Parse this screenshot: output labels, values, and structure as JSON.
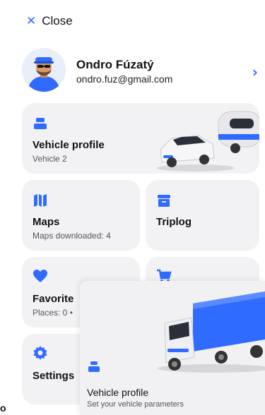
{
  "header": {
    "close_label": "Close",
    "close_icon": "close-icon"
  },
  "profile": {
    "name": "Ondro Fúzatý",
    "email": "ondro.fuz@gmail.com"
  },
  "cards": {
    "vehicle": {
      "title": "Vehicle profile",
      "subtitle": "Vehicle 2"
    },
    "maps": {
      "title": "Maps",
      "subtitle": "Maps downloaded: 4"
    },
    "triplog": {
      "title": "Triplog"
    },
    "favorites": {
      "title": "Favorite",
      "subtitle": "Places: 0 •"
    },
    "settings": {
      "title": "Settings"
    }
  },
  "overlay": {
    "title": "Vehicle profile",
    "subtitle": "Set your vehicle parameters"
  },
  "colors": {
    "accent": "#2f6bff",
    "card_bg": "#f2f2f4"
  }
}
